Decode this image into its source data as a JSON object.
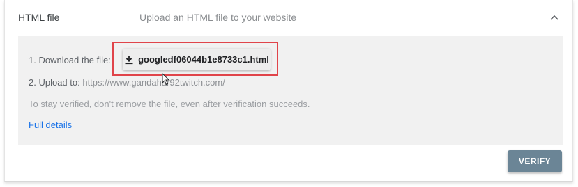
{
  "header": {
    "title": "HTML file",
    "subtitle": "Upload an HTML file to your website",
    "chevron_icon": "chevron-up-icon"
  },
  "panel": {
    "step1_label": "1. Download the file:",
    "file_name": "googledf06044b1e8733c1.html",
    "download_icon": "download-icon",
    "step2_label": "2. Upload to:",
    "upload_url": "https://www.gandahar92twitch.com/",
    "hint": "To stay verified, don't remove the file, even after verification succeeds.",
    "full_details": "Full details"
  },
  "verify_button": "VERIFY",
  "colors": {
    "highlight_border": "#e0444a",
    "link": "#1a73e8",
    "verify_bg": "#6b8596",
    "panel_bg": "#f1f1f1"
  }
}
